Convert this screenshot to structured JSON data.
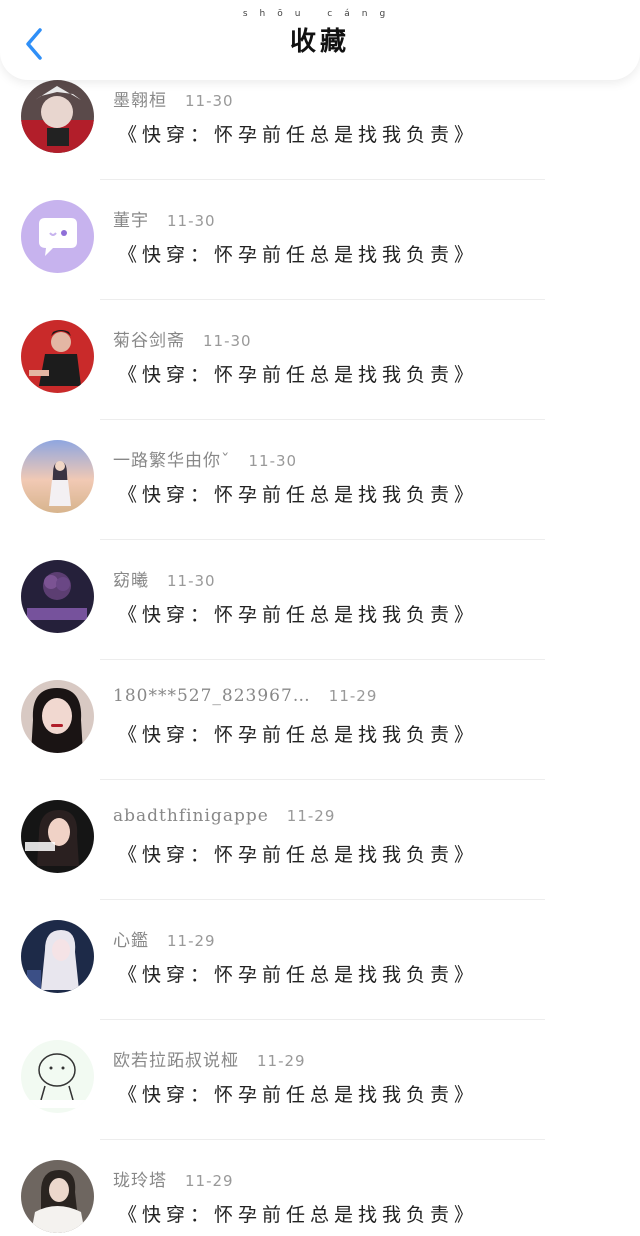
{
  "header": {
    "title": "收藏",
    "title_pinyin": "shōu cáng",
    "back_icon": "chevron-left-icon",
    "accent": "#2f8ff7"
  },
  "items": [
    {
      "username": "墨翱桓",
      "date": "11-30",
      "content": "《快穿：怀孕前任总是找我负责》",
      "avatar": "anime-character"
    },
    {
      "username": "董宇",
      "date": "11-30",
      "content": "《快穿：怀孕前任总是找我负责》",
      "avatar": "default-chat-bubble"
    },
    {
      "username": "菊谷剑斋",
      "date": "11-30",
      "content": "《快穿：怀孕前任总是找我负责》",
      "avatar": "man-red-background"
    },
    {
      "username": "一路繁华由你ˇ",
      "date": "11-30",
      "content": "《快穿：怀孕前任总是找我负责》",
      "avatar": "girl-sunset"
    },
    {
      "username": "窈曦",
      "date": "11-30",
      "content": "《快穿：怀孕前任总是找我负责》",
      "avatar": "dark-rose"
    },
    {
      "username": "180***527_823967…",
      "date": "11-29",
      "content": "《快穿：怀孕前任总是找我负责》",
      "avatar": "girl-portrait"
    },
    {
      "username": "abadthfinigappe",
      "date": "11-29",
      "content": "《快穿：怀孕前任总是找我负责》",
      "avatar": "girl-dark"
    },
    {
      "username": "心鑑",
      "date": "11-29",
      "content": "《快穿：怀孕前任总是找我负责》",
      "avatar": "white-hair-anime"
    },
    {
      "username": "欧若拉跖叔说桠",
      "date": "11-29",
      "content": "《快穿：怀孕前任总是找我负责》",
      "avatar": "sketch-cartoon"
    },
    {
      "username": "珑玲塔",
      "date": "11-29",
      "content": "《快穿：怀孕前任总是找我负责》",
      "avatar": "girl-white"
    }
  ]
}
